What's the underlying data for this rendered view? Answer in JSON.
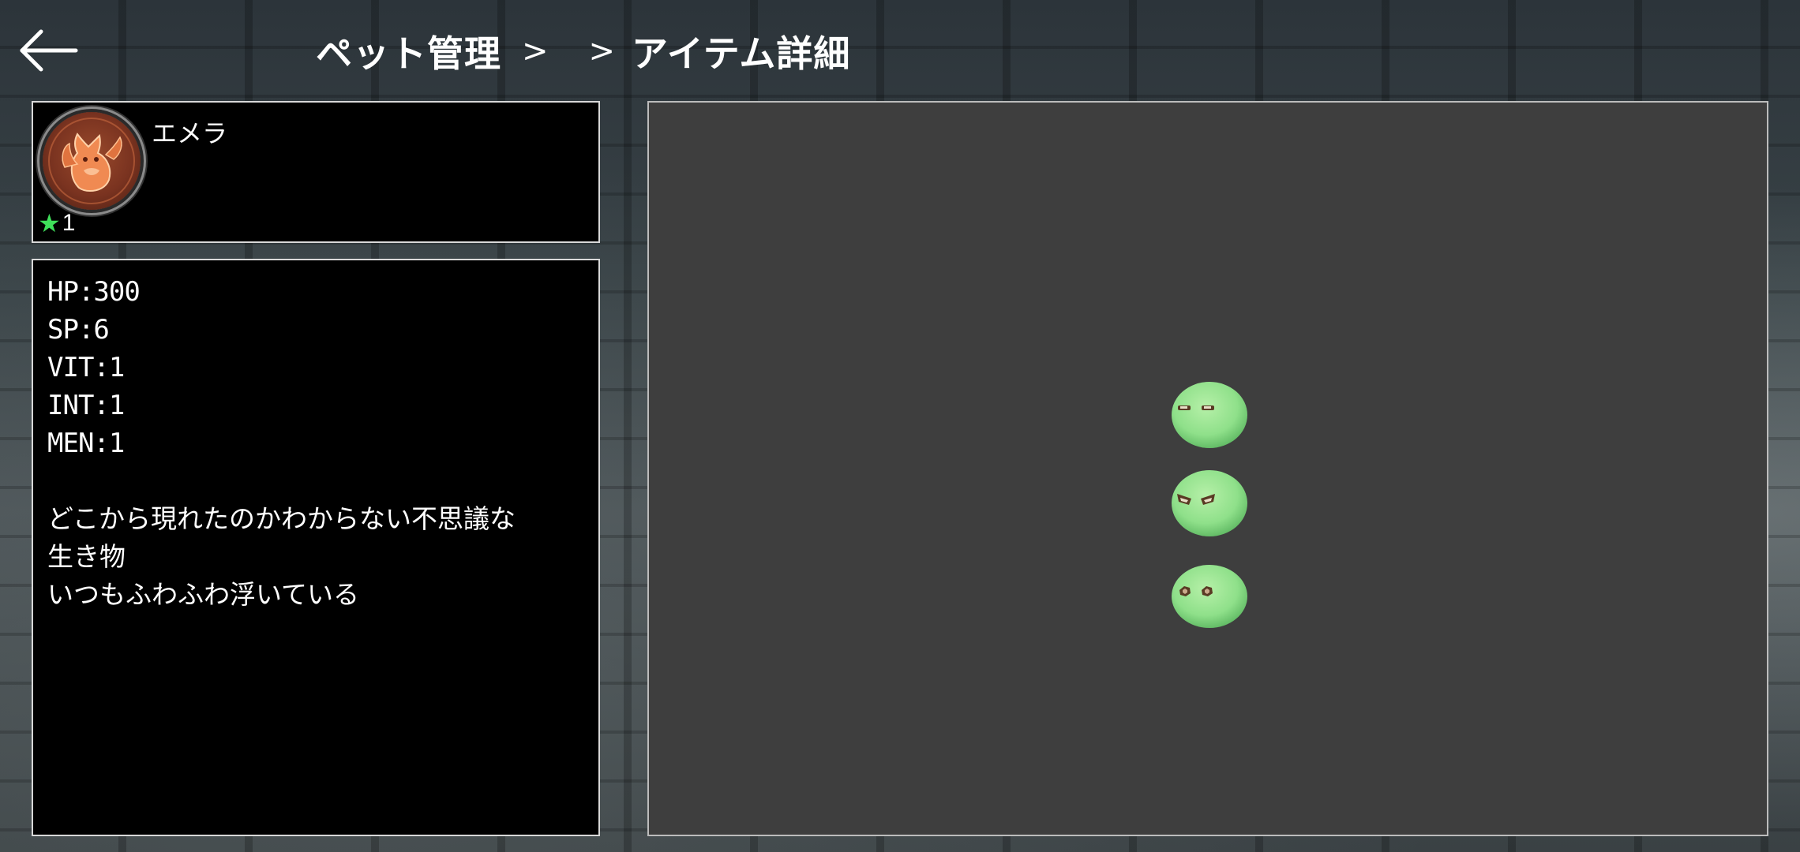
{
  "header": {
    "breadcrumb": [
      "ペット管理",
      "",
      "アイテム詳細"
    ],
    "separator": ">"
  },
  "icons": {
    "back": "arrow-left-icon",
    "rarity": "star-icon",
    "avatar": "fox-emblem-icon"
  },
  "pet": {
    "name": "エメラ",
    "rarity": "1",
    "stats": [
      "HP:300",
      "SP:6",
      "VIT:1",
      "INT:1",
      "MEN:1"
    ],
    "description": [
      "どこから現れたのかわからない不思議な",
      "生き物",
      "いつもふわふわ浮いている"
    ]
  },
  "preview": {
    "sprites": [
      "sleepy",
      "angry",
      "normal"
    ]
  },
  "colors": {
    "star": "#3fe05a",
    "preview_bg": "#3e3e3e",
    "sprite_body": "#8fe08a"
  }
}
